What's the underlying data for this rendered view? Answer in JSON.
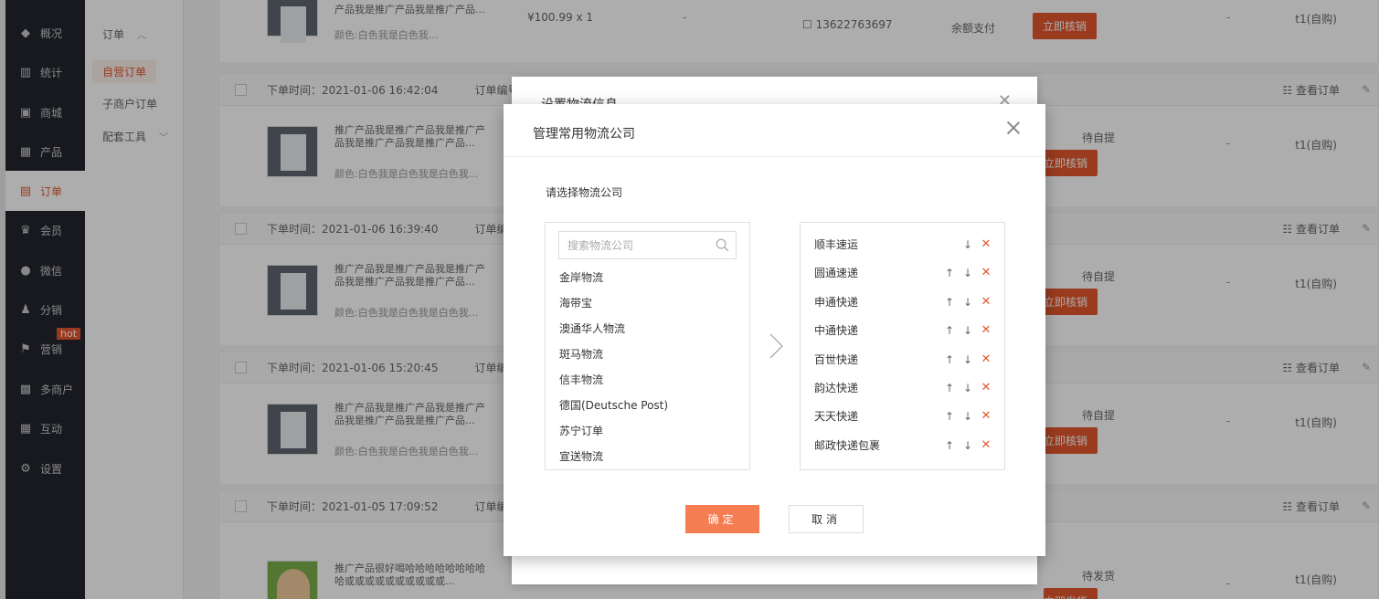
{
  "nav": {
    "items": [
      {
        "label": "概况",
        "icon": "dashboard-icon",
        "glyph": "◆"
      },
      {
        "label": "统计",
        "icon": "chart-icon",
        "glyph": "▥"
      },
      {
        "label": "商城",
        "icon": "shop-icon",
        "glyph": "▣"
      },
      {
        "label": "产品",
        "icon": "grid-icon",
        "glyph": "▦"
      },
      {
        "label": "订单",
        "icon": "order-icon",
        "glyph": "▤"
      },
      {
        "label": "会员",
        "icon": "crown-icon",
        "glyph": "♛"
      },
      {
        "label": "微信",
        "icon": "wechat-icon",
        "glyph": "●"
      },
      {
        "label": "分销",
        "icon": "users-icon",
        "glyph": "♟"
      },
      {
        "label": "营销",
        "icon": "flag-icon",
        "glyph": "⚑"
      },
      {
        "label": "多商户",
        "icon": "store-icon",
        "glyph": "▩"
      },
      {
        "label": "互动",
        "icon": "interaction-icon",
        "glyph": "▦"
      },
      {
        "label": "设置",
        "icon": "gear-icon",
        "glyph": "⚙"
      }
    ],
    "hot_badge": "hot",
    "active_color": "#e4572e"
  },
  "subnav": {
    "group": "订单",
    "items": [
      "自营订单",
      "子商户订单"
    ],
    "tools": "配套工具"
  },
  "orders": [
    {
      "time": "",
      "product_title": "产品我是推广产品我是推广产品...",
      "sku": "颜色:白色我是白色我...",
      "price": "¥100.99 x 1",
      "dash": "-",
      "phone": "13622763697",
      "pay": "余额支付",
      "action": "立即核销",
      "status": "",
      "buyer": "t1(自购)"
    },
    {
      "time": "下单时间：2021-01-06 16:42:04",
      "order_no": "订单编号：",
      "product_title": "推广产品我是推广产品我是推广产品我是推广产品我是推广产品...",
      "sku": "颜色:白色我是白色我是白色我...",
      "status": "待自提",
      "action": "立即核销",
      "buyer": "t1(自购)",
      "view": "查看订单"
    },
    {
      "time": "下单时间：2021-01-06 16:39:40",
      "order_no": "订单编号",
      "product_title": "推广产品我是推广产品我是推广产品我是推广产品我是推广产品...",
      "sku": "颜色:白色我是白色我是白色我...",
      "status": "待自提",
      "action": "立即核销",
      "buyer": "t1(自购)",
      "view": "查看订单"
    },
    {
      "time": "下单时间：2021-01-06 15:20:45",
      "order_no": "订单编号",
      "product_title": "推广产品我是推广产品我是推广产品我是推广产品我是推广产品...",
      "sku": "颜色:白色我是白色我是白色我...",
      "status": "待自提",
      "action": "立即核销",
      "buyer": "t1(自购)",
      "view": "查看订单"
    },
    {
      "time": "下单时间：2021-01-05 17:09:52",
      "order_no": "订单编号",
      "product_title": "推广产品很好喝哈哈哈哈哈哈哈哈哈或或或或或或或或或或...",
      "sku": "",
      "status": "待发货",
      "action": "立即发货",
      "buyer": "t1(自购)",
      "view": "查看订单"
    }
  ],
  "back_modal": {
    "title": "设置物流信息"
  },
  "modal": {
    "title": "管理常用物流公司",
    "select_label": "请选择物流公司",
    "search_placeholder": "搜索物流公司",
    "companies": [
      "金岸物流",
      "海带宝",
      "澳通华人物流",
      "斑马物流",
      "信丰物流",
      "德国(Deutsche Post)",
      "苏宁订单",
      "宣送物流"
    ],
    "selected": [
      {
        "name": "顺丰速运",
        "up": false,
        "down": true
      },
      {
        "name": "圆通速递",
        "up": true,
        "down": true
      },
      {
        "name": "申通快递",
        "up": true,
        "down": true
      },
      {
        "name": "中通快递",
        "up": true,
        "down": true
      },
      {
        "name": "百世快递",
        "up": true,
        "down": true
      },
      {
        "name": "韵达快递",
        "up": true,
        "down": true
      },
      {
        "name": "天天快递",
        "up": true,
        "down": true
      },
      {
        "name": "邮政快递包裹",
        "up": true,
        "down": true
      }
    ],
    "confirm_label": "确定",
    "cancel_label": "取消",
    "confirm_color": "#f47d52"
  }
}
